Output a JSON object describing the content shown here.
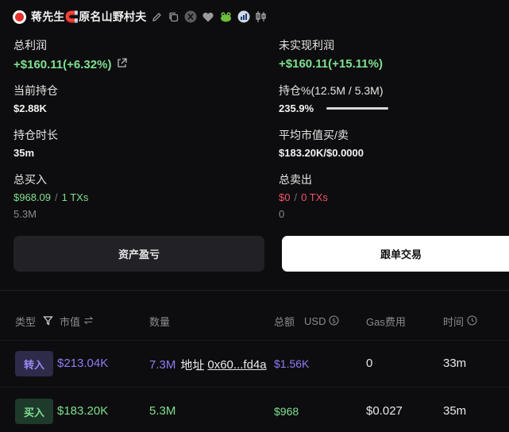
{
  "header": {
    "name": "蒋先生🧲原名山野村夫"
  },
  "stats": {
    "total_profit": {
      "label": "总利润",
      "value": "+$160.11(+6.32%)"
    },
    "unrealized": {
      "label": "未实现利润",
      "value": "+$160.11(+15.11%)"
    },
    "holding": {
      "label": "当前持仓",
      "value": "$2.88K"
    },
    "holding_pct": {
      "label": "持仓%(12.5M / 5.3M)",
      "value": "235.9%",
      "progress": 1.0
    },
    "duration": {
      "label": "持仓时长",
      "value": "35m"
    },
    "avg_mcap": {
      "label": "平均市值买/卖",
      "value": "$183.20K/$0.0000"
    },
    "total_buy": {
      "label": "总买入",
      "amount": "$968.09",
      "sep": "/",
      "txs": "1 TXs",
      "qty": "5.3M"
    },
    "total_sell": {
      "label": "总卖出",
      "amount": "$0",
      "sep": "/",
      "txs": "0 TXs",
      "qty": "0"
    }
  },
  "buttons": {
    "pnl": "资产盈亏",
    "copy_trade": "跟单交易"
  },
  "table": {
    "headers": {
      "type": "类型",
      "mcap": "市值",
      "qty": "数量",
      "total": "总额",
      "currency": "USD",
      "gas": "Gas费用",
      "time": "时间"
    },
    "rows": [
      {
        "type": "转入",
        "mcap": "$213.04K",
        "qty": "7.3M",
        "addr_label": "地址",
        "addr": "0x60...fd4a",
        "total": "$1.56K",
        "gas": "0",
        "time": "33m"
      },
      {
        "type": "买入",
        "mcap": "$183.20K",
        "qty": "5.3M",
        "total": "$968",
        "gas": "$0.027",
        "time": "35m"
      }
    ]
  },
  "colors": {
    "green": "#7fe08e",
    "red": "#f2526a",
    "purple": "#8f7cf4",
    "background": "#0d0d0f"
  }
}
